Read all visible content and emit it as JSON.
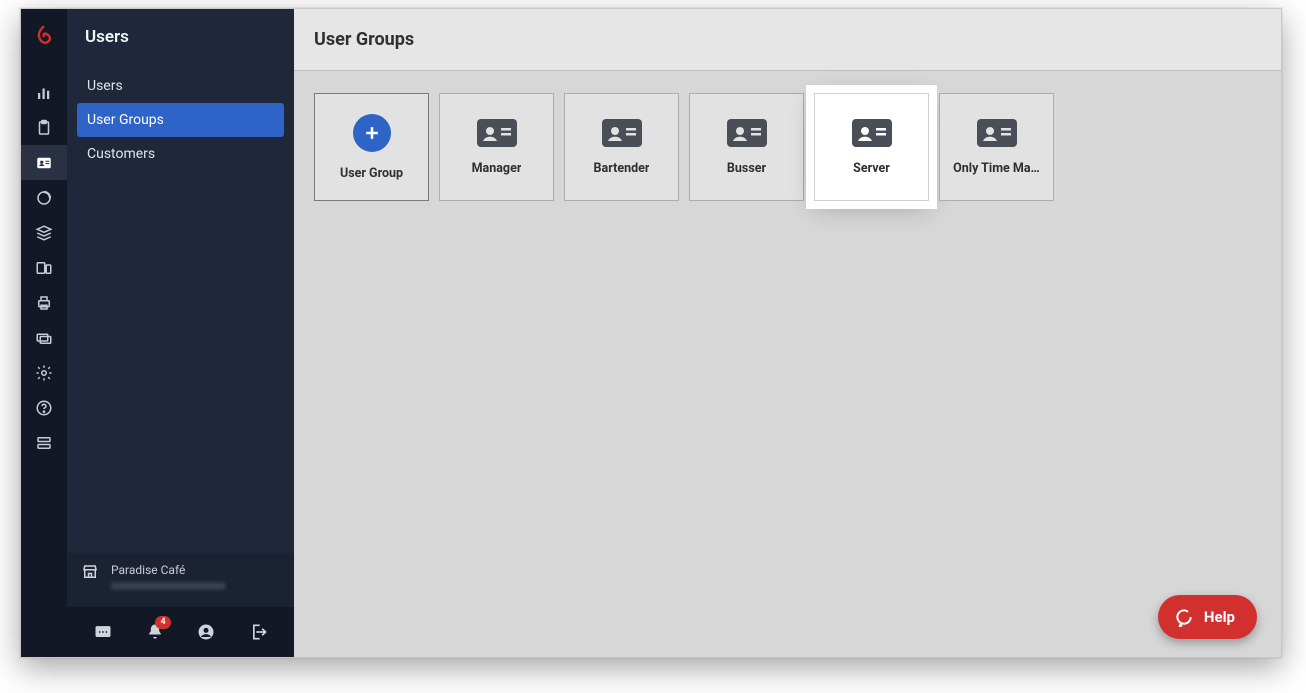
{
  "sidebar": {
    "title": "Users",
    "items": [
      {
        "label": "Users",
        "active": false
      },
      {
        "label": "User Groups",
        "active": true
      },
      {
        "label": "Customers",
        "active": false
      }
    ]
  },
  "footer": {
    "store_name": "Paradise Café",
    "store_sub": "xxxxxxxxxxxxxxxxxxxxx"
  },
  "notifications": {
    "count": "4"
  },
  "main": {
    "title": "User Groups",
    "add_label": "User Group",
    "groups": [
      {
        "label": "Manager"
      },
      {
        "label": "Bartender"
      },
      {
        "label": "Busser"
      },
      {
        "label": "Server",
        "highlight": true
      },
      {
        "label": "Only Time Ma…"
      }
    ]
  },
  "help": {
    "label": "Help"
  }
}
